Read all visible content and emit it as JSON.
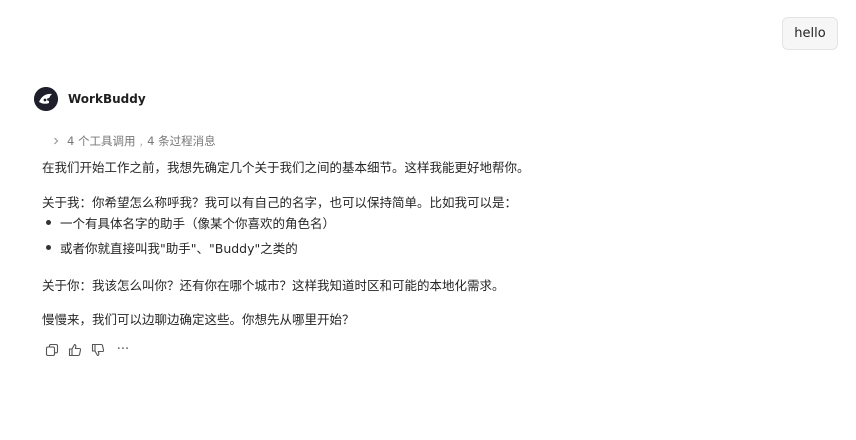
{
  "user_message": "hello",
  "agent": {
    "name": "WorkBuddy"
  },
  "process": {
    "tool_calls": "4 个工具调用",
    "separator": ",",
    "messages": "4 条过程消息"
  },
  "reply": {
    "p1": "在我们开始工作之前，我想先确定几个关于我们之间的基本细节。这样我能更好地帮你。",
    "p2": "关于我：你希望怎么称呼我？我可以有自己的名字，也可以保持简单。比如我可以是：",
    "bullets": [
      "一个有具体名字的助手（像某个你喜欢的角色名）",
      "或者你就直接叫我\"助手\"、\"Buddy\"之类的"
    ],
    "p3": "关于你：我该怎么叫你？还有你在哪个城市？这样我知道时区和可能的本地化需求。",
    "p4": "慢慢来，我们可以边聊边确定这些。你想先从哪里开始？"
  },
  "actions": {
    "more_label": "···"
  },
  "icons": {
    "copy": "copy-icon",
    "like": "thumbs-up-icon",
    "dislike": "thumbs-down-icon",
    "more": "more-icon",
    "expand": "chevron-right-icon"
  }
}
